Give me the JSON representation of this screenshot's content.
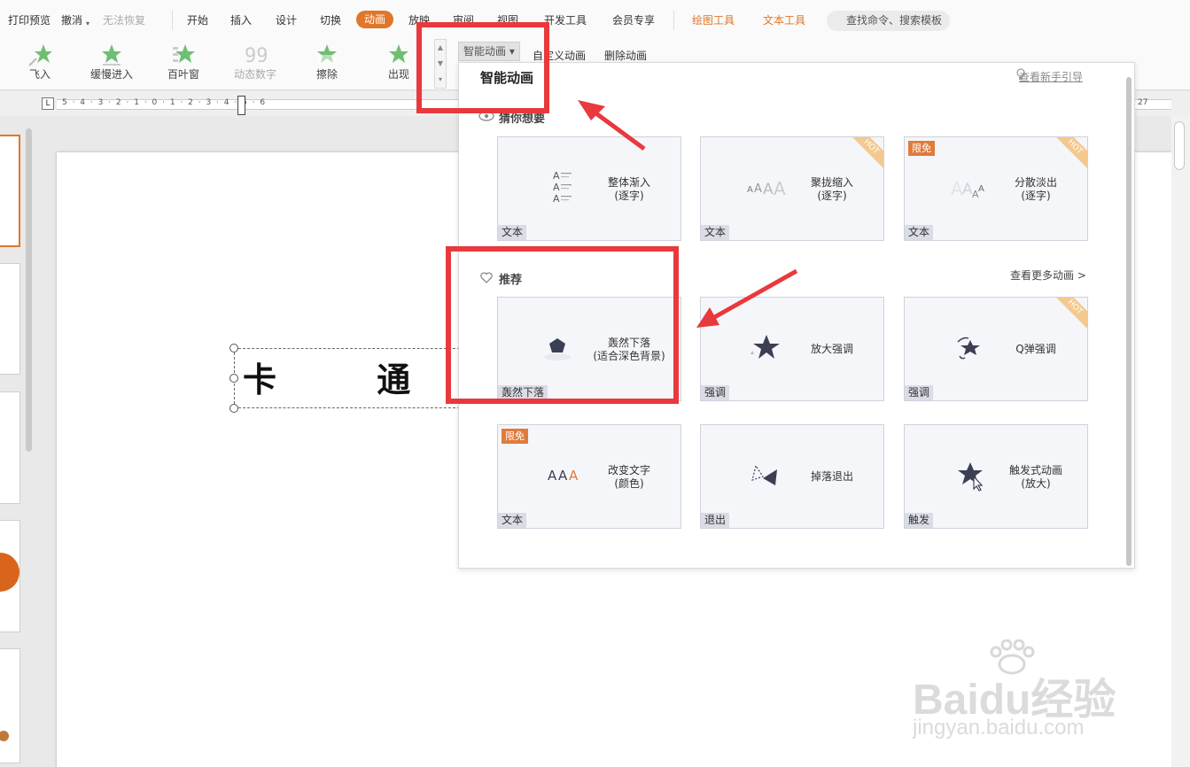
{
  "menubar": {
    "quick_items": [
      "打印预览",
      "撤消",
      "无法恢复"
    ],
    "tabs": [
      "开始",
      "插入",
      "设计",
      "切换",
      "动画",
      "放映",
      "审阅",
      "视图",
      "开发工具",
      "会员专享"
    ],
    "active_tab": "动画",
    "tool_tabs": [
      "绘图工具",
      "文本工具"
    ],
    "search_placeholder": "查找命令、搜索模板"
  },
  "ribbon": {
    "effects": [
      "飞入",
      "缓慢进入",
      "百叶窗",
      "动态数字",
      "擦除",
      "出现"
    ],
    "smart_animation": "智能动画",
    "custom_animation": "自定义动画",
    "delete_animation": "删除动画"
  },
  "ruler": {
    "left_numbers": "5 · 4 · 3 · 2 · 1 · 0 · 1 · 2 · 3 · 4 · 5 · 6",
    "right_number": "27"
  },
  "slide": {
    "text": "卡 通 小"
  },
  "panel": {
    "title": "智能动画",
    "guide_link": "查看新手引导",
    "section_guess": "猜你想要",
    "section_recommend": "推荐",
    "more_link": "查看更多动画 >",
    "guess_cards": [
      {
        "title": "整体渐入",
        "subtitle": "(逐字)",
        "tag": "文本",
        "badge": "",
        "hot": ""
      },
      {
        "title": "聚拢缩入",
        "subtitle": "(逐字)",
        "tag": "文本",
        "badge": "",
        "hot": "HOT"
      },
      {
        "title": "分散淡出",
        "subtitle": "(逐字)",
        "tag": "文本",
        "badge": "限免",
        "hot": "HOT"
      }
    ],
    "recommend_cards": [
      {
        "title": "轰然下落",
        "subtitle": "(适合深色背景)",
        "tag": "轰然下落",
        "badge": "",
        "hot": ""
      },
      {
        "title": "放大强调",
        "subtitle": "",
        "tag": "强调",
        "badge": "",
        "hot": ""
      },
      {
        "title": "Q弹强调",
        "subtitle": "",
        "tag": "强调",
        "badge": "",
        "hot": "HOT"
      },
      {
        "title": "改变文字",
        "subtitle": "(颜色)",
        "tag": "文本",
        "badge": "限免",
        "hot": ""
      },
      {
        "title": "掉落退出",
        "subtitle": "",
        "tag": "退出",
        "badge": "",
        "hot": ""
      },
      {
        "title": "触发式动画",
        "subtitle": "(放大)",
        "tag": "触发",
        "badge": "",
        "hot": ""
      }
    ]
  },
  "watermark": {
    "logo": "Baidu经验",
    "url": "jingyan.baidu.com"
  },
  "colors": {
    "accent": "#e0762a",
    "annotation_red": "#e8393c",
    "star_green": "#6fbf73",
    "icon_dark": "#3b3f52"
  }
}
